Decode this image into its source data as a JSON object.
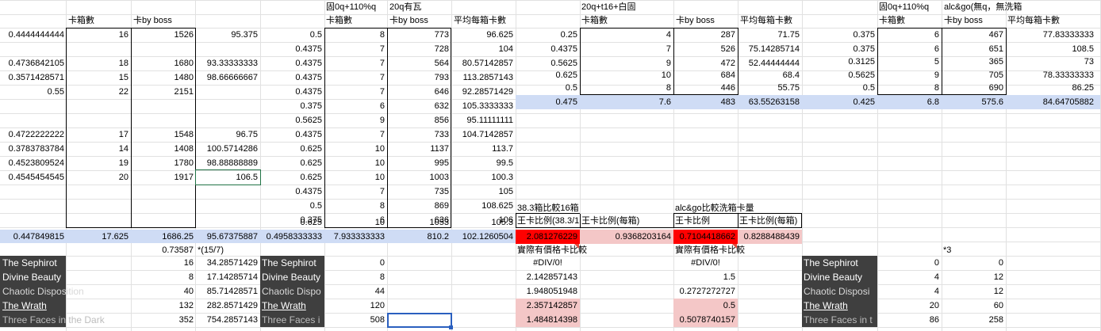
{
  "sheet": {
    "headers": {
      "a_box": "卡箱數",
      "a_boss": "卡by boss",
      "b_title": "固0q+110%q",
      "b_title2": "20q有瓦",
      "b_box": "卡箱數",
      "b_boss": "卡by boss",
      "b_avg": "平均每箱卡數",
      "c_title": "20q+t16+白固",
      "c_box": "卡箱數",
      "c_boss": "卡by boss",
      "c_avg": "平均每箱卡數",
      "d_title": "固0q+110%q",
      "d_title2": "alc&go(無q，無洗箱",
      "d_box": "卡箱數",
      "d_boss": "卡by boss",
      "d_avg": "平均每箱卡數"
    },
    "block_a": [
      [
        "0.4444444444",
        "16",
        "1526",
        "95.375"
      ],
      [
        "",
        "",
        "",
        ""
      ],
      [
        "0.4736842105",
        "18",
        "1680",
        "93.33333333"
      ],
      [
        "0.3571428571",
        "15",
        "1480",
        "98.66666667"
      ],
      [
        "0.55",
        "22",
        "2151",
        ""
      ],
      [
        "",
        "",
        "",
        ""
      ],
      [
        "",
        "",
        "",
        ""
      ],
      [
        "",
        "",
        "",
        ""
      ],
      [
        "0.4722222222",
        "17",
        "1548",
        "96.75"
      ],
      [
        "0.3783783784",
        "14",
        "1408",
        "100.5714286"
      ],
      [
        "0.4523809524",
        "19",
        "1780",
        "98.88888889"
      ],
      [
        "0.4545454545",
        "20",
        "1917",
        "106.5"
      ]
    ],
    "block_b": [
      [
        "0.5",
        "8",
        "773",
        "96.625"
      ],
      [
        "0.4375",
        "7",
        "728",
        "104"
      ],
      [
        "0.4375",
        "7",
        "564",
        "80.57142857"
      ],
      [
        "0.4375",
        "7",
        "793",
        "113.2857143"
      ],
      [
        "0.4375",
        "7",
        "646",
        "92.28571429"
      ],
      [
        "0.375",
        "6",
        "632",
        "105.3333333"
      ],
      [
        "0.5625",
        "9",
        "856",
        "95.11111111"
      ],
      [
        "0.4375",
        "7",
        "733",
        "104.7142857"
      ],
      [
        "0.625",
        "10",
        "1137",
        "113.7"
      ],
      [
        "0.625",
        "10",
        "995",
        "99.5"
      ],
      [
        "0.625",
        "10",
        "1003",
        "100.3"
      ],
      [
        "0.4375",
        "7",
        "735",
        "105"
      ],
      [
        "0.5",
        "8",
        "869",
        "108.625"
      ],
      [
        "0.375",
        "6",
        "636",
        "106"
      ],
      [
        "0.625",
        "10",
        "1053",
        "105.3"
      ]
    ],
    "block_c": [
      [
        "0.25",
        "4",
        "287",
        "71.75"
      ],
      [
        "0.4375",
        "7",
        "526",
        "75.14285714"
      ],
      [
        "0.5625",
        "9",
        "472",
        "52.44444444"
      ],
      [
        "0.625",
        "10",
        "684",
        "68.4"
      ],
      [
        "0.5",
        "8",
        "446",
        "55.75"
      ]
    ],
    "block_c_avg": [
      "0.475",
      "7.6",
      "483",
      "63.55263158"
    ],
    "block_d": [
      [
        "0.375",
        "6",
        "467",
        "77.83333333"
      ],
      [
        "0.375",
        "6",
        "651",
        "108.5"
      ],
      [
        "0.3125",
        "5",
        "365",
        "73"
      ],
      [
        "0.5625",
        "9",
        "705",
        "78.33333333"
      ],
      [
        "0.5",
        "8",
        "690",
        "86.25"
      ]
    ],
    "block_d_avg": [
      "0.425",
      "6.8",
      "575.6",
      "84.64705882"
    ],
    "summary_row": [
      "0.447849815",
      "17.625",
      "1686.25",
      "95.67375887",
      "0.4958333333",
      "7.933333333",
      "810.2",
      "102.1260504"
    ],
    "note_ratio": "0.73587",
    "note_text": "*(15/7)",
    "note_star3": "*3",
    "compare1": {
      "header": "38.3箱比較16箱",
      "col1": "王卡比例(38.3/1(",
      "col2": "王卡比例(每箱)",
      "val1": "2.081276229",
      "val2": "0.9368203164",
      "sub": "實際有價格卡比較",
      "rows": [
        "#DIV/0!",
        "2.142857143",
        "1.948051948",
        "2.357142857",
        "1.484814398"
      ]
    },
    "compare2": {
      "header": "alc&go比較洗箱卡量",
      "col1": "王卡比例",
      "col2": "王卡比例(每箱)",
      "val1": "0.7104418662",
      "val2": "0.8288488439",
      "sub": "實際有價格卡比較",
      "rows": [
        "#DIV/0!",
        "1.5",
        "0.2727272727",
        "0.5",
        "0.5078740157"
      ]
    },
    "cards": [
      "The Sephirot",
      "Divine Beauty",
      "Chaotic Disposition",
      "The Wrath",
      "Three Faces in the Dark"
    ],
    "cards_b": [
      "The Sephirot",
      "Divine Beauty",
      "Chaotic Dispo",
      "The Wrath",
      "Three Faces i"
    ],
    "cards_d": [
      "The Sephirot",
      "Divine Beauty",
      "Chaotic Disposi",
      "The Wrath",
      "Three Faces in t"
    ],
    "cards_a_vals": [
      [
        "16",
        "34.28571429"
      ],
      [
        "8",
        "17.14285714"
      ],
      [
        "40",
        "85.71428571"
      ],
      [
        "132",
        "282.8571429"
      ],
      [
        "352",
        "754.2857143"
      ]
    ],
    "cards_b_vals": [
      "0",
      "8",
      "44",
      "120",
      "508"
    ],
    "cards_d_vals": [
      [
        "0",
        "0"
      ],
      [
        "4",
        "12"
      ],
      [
        "4",
        "12"
      ],
      [
        "20",
        "60"
      ],
      [
        "86",
        "258"
      ]
    ],
    "colors": {
      "summary_blue": "#cfdcf5",
      "red_cell": "#ff0000",
      "pink_cell": "#f4c7c7",
      "dark_cell": "#3f3f3f",
      "grid": "#e1e1e1"
    }
  }
}
